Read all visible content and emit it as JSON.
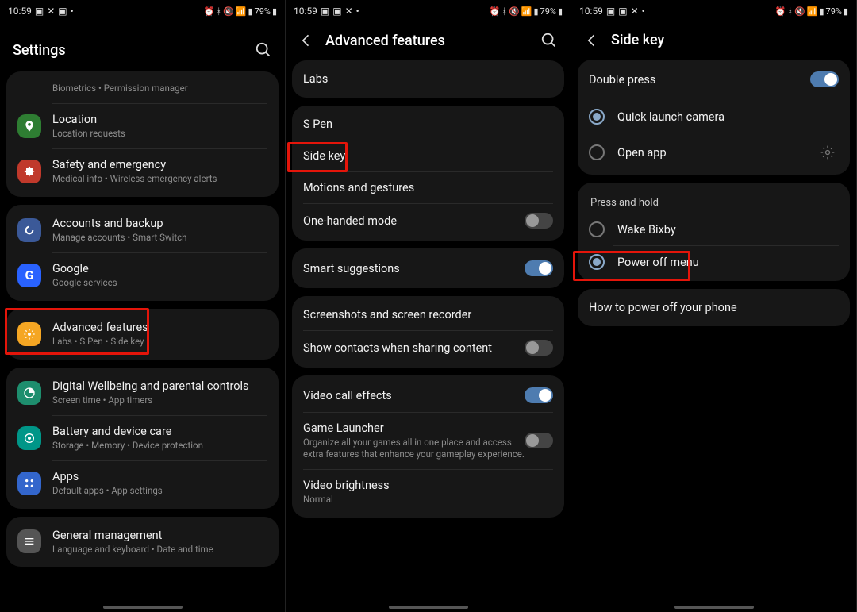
{
  "status": {
    "time": "10:59",
    "battery": "79%"
  },
  "screen1": {
    "title": "Settings",
    "partial_title": "Biometrics",
    "partial_sub_sep": " • ",
    "partial_sub_2": "Permission manager",
    "items": [
      {
        "title": "Location",
        "sub": "Location requests"
      },
      {
        "title": "Safety and emergency",
        "sub": "Medical info  •  Wireless emergency alerts"
      },
      {
        "title": "Accounts and backup",
        "sub": "Manage accounts  •  Smart Switch"
      },
      {
        "title": "Google",
        "sub": "Google services"
      },
      {
        "title": "Advanced features",
        "sub": "Labs  •  S Pen  •  Side key"
      },
      {
        "title": "Digital Wellbeing and parental controls",
        "sub": "Screen time  •  App timers"
      },
      {
        "title": "Battery and device care",
        "sub": "Storage  •  Memory  •  Device protection"
      },
      {
        "title": "Apps",
        "sub": "Default apps  •  App settings"
      },
      {
        "title": "General management",
        "sub": "Language and keyboard  •  Date and time"
      }
    ]
  },
  "screen2": {
    "title": "Advanced features",
    "items": [
      {
        "title": "Labs"
      },
      {
        "title": "S Pen"
      },
      {
        "title": "Side key"
      },
      {
        "title": "Motions and gestures"
      },
      {
        "title": "One-handed mode",
        "toggle": "off"
      },
      {
        "title": "Smart suggestions",
        "toggle": "on"
      },
      {
        "title": "Screenshots and screen recorder"
      },
      {
        "title": "Show contacts when sharing content",
        "toggle": "off"
      },
      {
        "title": "Video call effects",
        "toggle": "on"
      },
      {
        "title": "Game Launcher",
        "sub": "Organize all your games all in one place and access extra features that enhance your gameplay experience.",
        "toggle": "off"
      },
      {
        "title": "Video brightness",
        "sub": "Normal"
      }
    ]
  },
  "screen3": {
    "title": "Side key",
    "double_press": {
      "label": "Double press",
      "opt1": "Quick launch camera",
      "opt2": "Open app"
    },
    "press_hold": {
      "label": "Press and hold",
      "opt1": "Wake Bixby",
      "opt2": "Power off menu"
    },
    "howto": "How to power off your phone"
  }
}
